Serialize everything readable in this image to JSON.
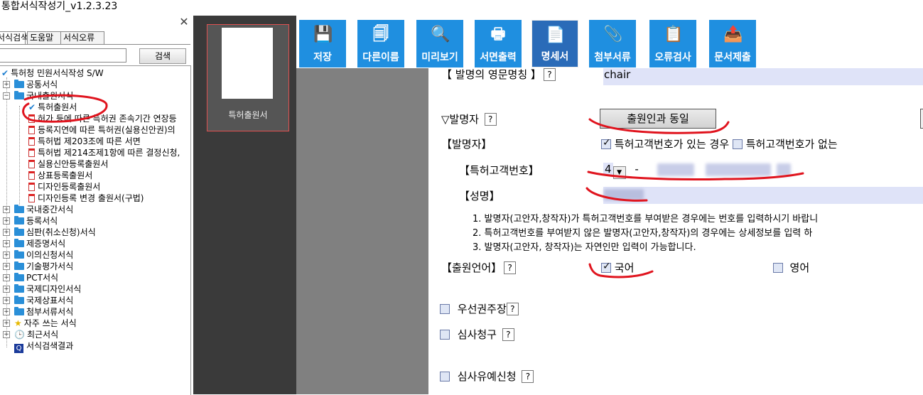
{
  "app": {
    "title": "통합서식작성기_v1.2.3.23",
    "close_glyph": "✕"
  },
  "left": {
    "tabs": [
      "서식검색",
      "도움말",
      "서식오류"
    ],
    "search_button": "검색",
    "search_value": "",
    "tree": [
      {
        "label": "특허청 민원서식작성 S/W",
        "kind": "check"
      },
      {
        "label": "공통서식",
        "kind": "folder"
      },
      {
        "label": "국내출원서식",
        "kind": "folder"
      },
      {
        "label": "특허출원서",
        "kind": "check"
      },
      {
        "label": "허가 등에 따른 특허권 존속기간 연장등",
        "kind": "doc"
      },
      {
        "label": "등록지연에 따른 특허권(실용신안권)의",
        "kind": "doc"
      },
      {
        "label": "특허법 제203조에 따른 서면",
        "kind": "doc"
      },
      {
        "label": "특허법 제214조제1항에 따른 결정신청,",
        "kind": "doc"
      },
      {
        "label": "실용신안등록출원서",
        "kind": "doc"
      },
      {
        "label": "상표등록출원서",
        "kind": "doc"
      },
      {
        "label": "디자인등록출원서",
        "kind": "doc"
      },
      {
        "label": "디자인등록 변경 출원서(구법)",
        "kind": "doc"
      },
      {
        "label": "국내중간서식",
        "kind": "folder"
      },
      {
        "label": "등록서식",
        "kind": "folder"
      },
      {
        "label": "심판(취소신청)서식",
        "kind": "folder"
      },
      {
        "label": "제증명서식",
        "kind": "folder"
      },
      {
        "label": "이의신청서식",
        "kind": "folder"
      },
      {
        "label": "기술평가서식",
        "kind": "folder"
      },
      {
        "label": "PCT서식",
        "kind": "folder"
      },
      {
        "label": "국제디자인서식",
        "kind": "folder"
      },
      {
        "label": "국제상표서식",
        "kind": "folder"
      },
      {
        "label": "첨부서류서식",
        "kind": "folder"
      },
      {
        "label": "자주 쓰는 서식",
        "kind": "star"
      },
      {
        "label": "최근서식",
        "kind": "clock"
      },
      {
        "label": "서식검색결과",
        "kind": "search"
      }
    ]
  },
  "thumb": {
    "label": "특허출원서"
  },
  "toolbar": [
    {
      "label": "저장",
      "icon": "save-icon",
      "glyph": "💾"
    },
    {
      "label": "다른이름",
      "icon": "save-as-icon",
      "glyph": "🗐"
    },
    {
      "label": "미리보기",
      "icon": "preview-icon",
      "glyph": "🔍"
    },
    {
      "label": "서면출력",
      "icon": "print-icon",
      "glyph": "🖶"
    },
    {
      "label": "명세서",
      "icon": "specification-icon",
      "glyph": "📄"
    },
    {
      "label": "첨부서류",
      "icon": "attachment-icon",
      "glyph": "📎"
    },
    {
      "label": "오류검사",
      "icon": "error-check-icon",
      "glyph": "📋"
    },
    {
      "label": "문서제출",
      "icon": "submit-icon",
      "glyph": "📤"
    }
  ],
  "form": {
    "english_name_label": "【 발명의 영문명칭 】",
    "english_name_value": "chair",
    "help": "?",
    "inventor_section": "▽발명자",
    "same_as_applicant": "출원인과 동일",
    "inventor_label": "【발명자】",
    "has_customer_no": "특허고객번호가 있는 경우",
    "no_customer_no": "특허고객번호가 없는",
    "customer_no_label": "【특허고객번호】",
    "customer_no_first": "4",
    "dash": "-",
    "name_label": "【성명】",
    "notes": [
      "1. 발명자(고안자,창작자)가 특허고객번호를 부여받은 경우에는 번호를 입력하시기 바랍니",
      "2. 특허고객번호를 부여받지 않은 발명자(고안자,창작자)의 경우에는 상세정보를 입력 하",
      "3. 발명자(고안자, 창작자)는 자연인만 입력이 가능합니다."
    ],
    "language_label": "【출원언어】",
    "korean": "국어",
    "english": "영어",
    "priority": "우선권주장",
    "exam_request": "심사청구",
    "deferred_exam": "심사유예신청"
  }
}
